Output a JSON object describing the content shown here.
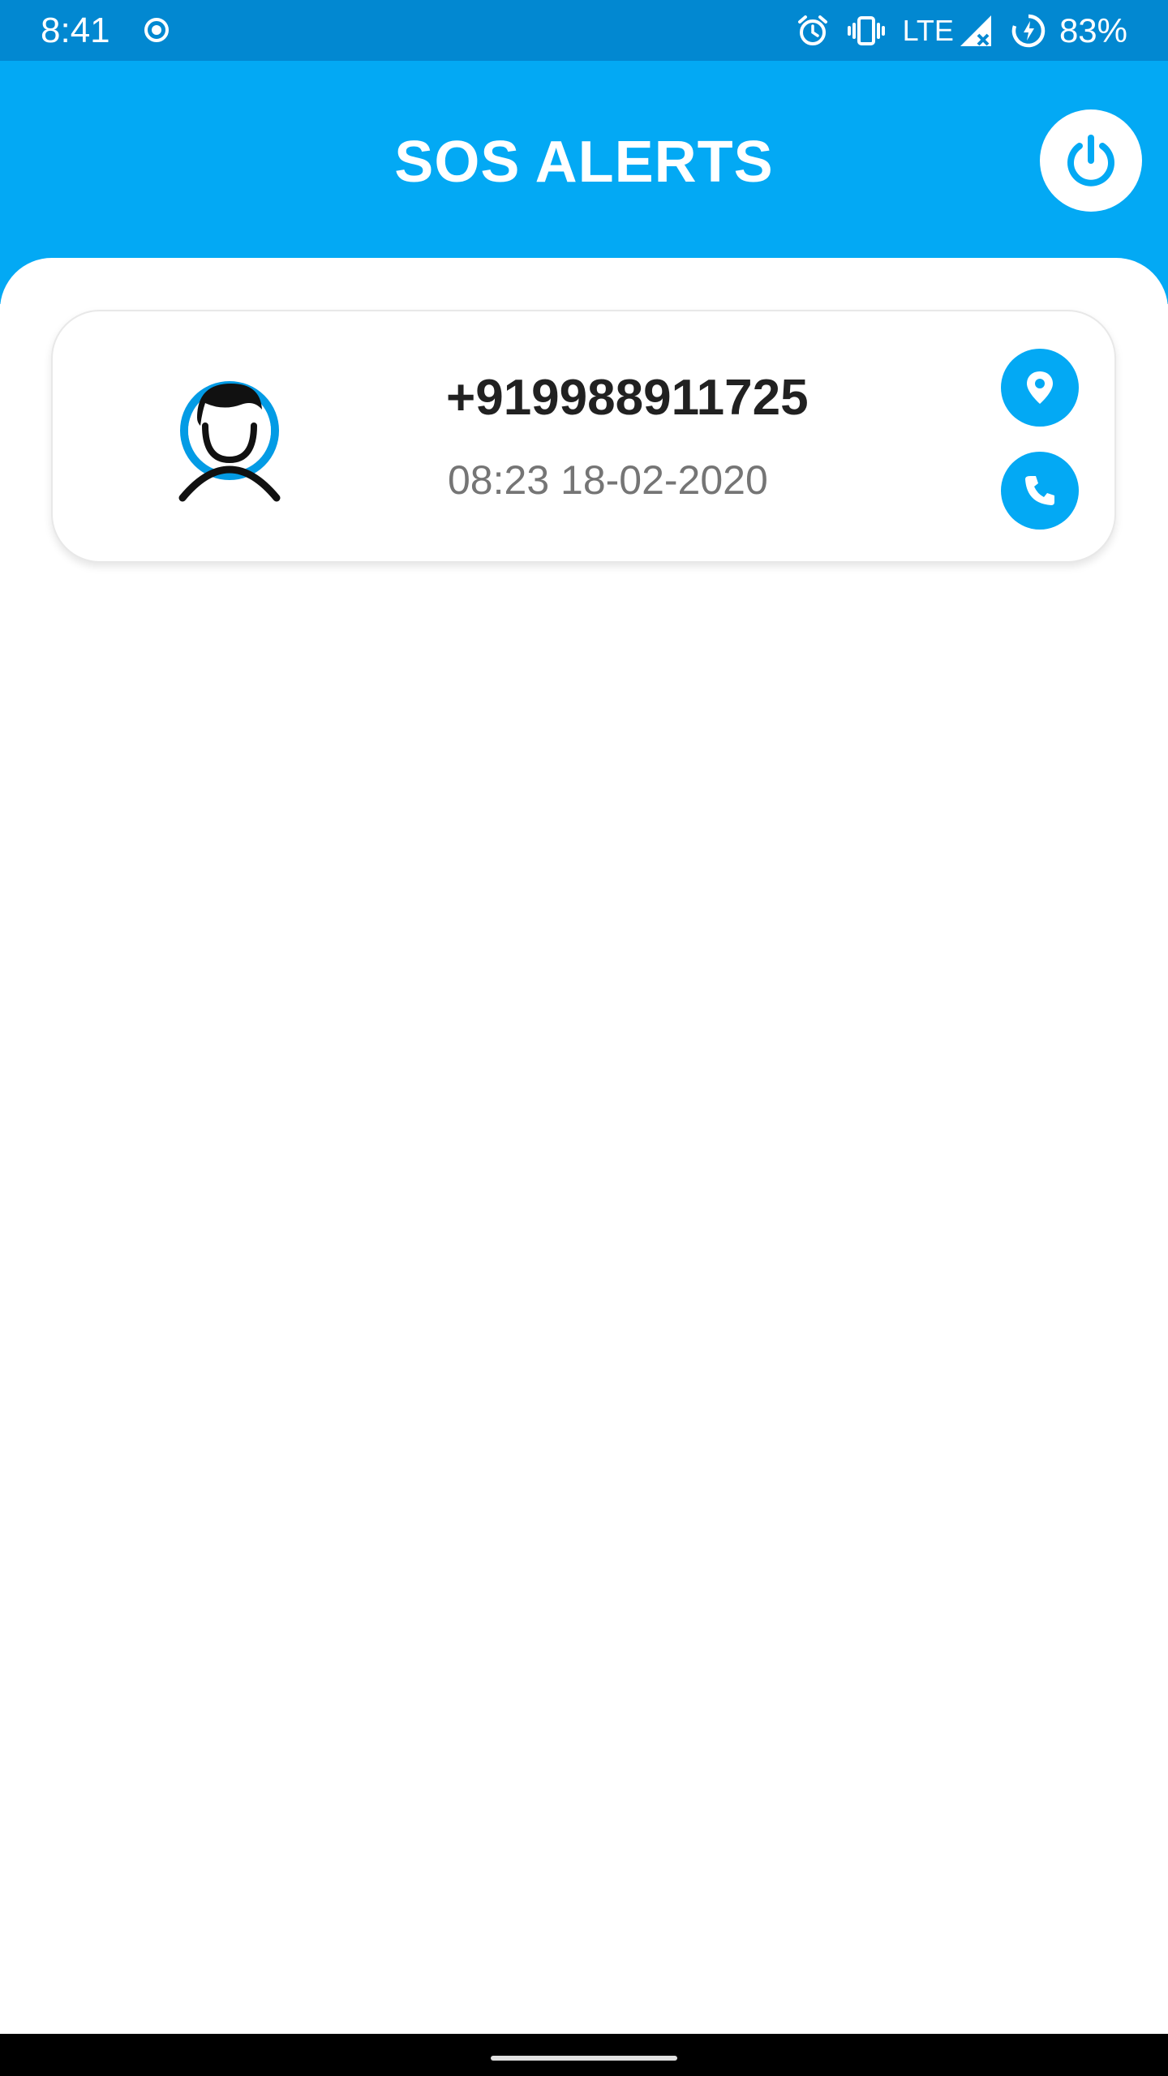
{
  "status_bar": {
    "time": "8:41",
    "network": "LTE",
    "battery": "83%",
    "icons": [
      "record-icon",
      "alarm-icon",
      "vibrate-icon",
      "signal-icon",
      "battery-saver-icon"
    ]
  },
  "app_bar": {
    "title": "SOS ALERTS",
    "power_icon": "power-icon"
  },
  "alerts": [
    {
      "phone": "+919988911725",
      "datetime": "08:23 18-02-2020",
      "avatar_icon": "user-avatar-icon",
      "location_icon": "location-pin-icon",
      "call_icon": "phone-icon"
    }
  ],
  "colors": {
    "status_bar": "#0288d1",
    "primary": "#03a9f4",
    "title_text": "#ffffff",
    "phone_text": "#212121",
    "time_text": "#757575"
  }
}
